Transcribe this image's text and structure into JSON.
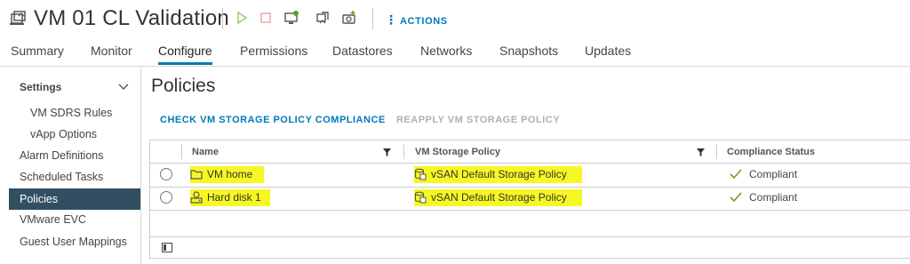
{
  "header": {
    "title": "VM 01 CL Validation",
    "actions_label": "ACTIONS",
    "icons": [
      "vm-icon",
      "power-on-icon",
      "power-off-icon",
      "launch-console-icon",
      "migrate-icon",
      "snapshot-icon"
    ]
  },
  "tabs": [
    {
      "label": "Summary",
      "active": false
    },
    {
      "label": "Monitor",
      "active": false
    },
    {
      "label": "Configure",
      "active": true
    },
    {
      "label": "Permissions",
      "active": false
    },
    {
      "label": "Datastores",
      "active": false
    },
    {
      "label": "Networks",
      "active": false
    },
    {
      "label": "Snapshots",
      "active": false
    },
    {
      "label": "Updates",
      "active": false
    }
  ],
  "sidebar": {
    "section": "Settings",
    "items": [
      {
        "label": "VM SDRS Rules"
      },
      {
        "label": "vApp Options"
      },
      {
        "label": "Alarm Definitions"
      },
      {
        "label": "Scheduled Tasks"
      },
      {
        "label": "Policies",
        "active": true
      },
      {
        "label": "VMware EVC"
      },
      {
        "label": "Guest User Mappings"
      }
    ]
  },
  "main": {
    "title": "Policies",
    "check_label": "CHECK VM STORAGE POLICY COMPLIANCE",
    "reapply_label": "REAPPLY VM STORAGE POLICY"
  },
  "table": {
    "columns": [
      "Name",
      "VM Storage Policy",
      "Compliance Status"
    ],
    "rows": [
      {
        "name": "VM home",
        "icon": "folder-icon",
        "policy": "vSAN Default Storage Policy",
        "status": "Compliant"
      },
      {
        "name": "Hard disk 1",
        "icon": "hard-disk-icon",
        "policy": "vSAN Default Storage Policy",
        "status": "Compliant"
      }
    ]
  },
  "colors": {
    "accent": "#0079b8",
    "sidebar_active": "#324f61",
    "highlight": "#f7f724",
    "compliant": "#62a420"
  }
}
